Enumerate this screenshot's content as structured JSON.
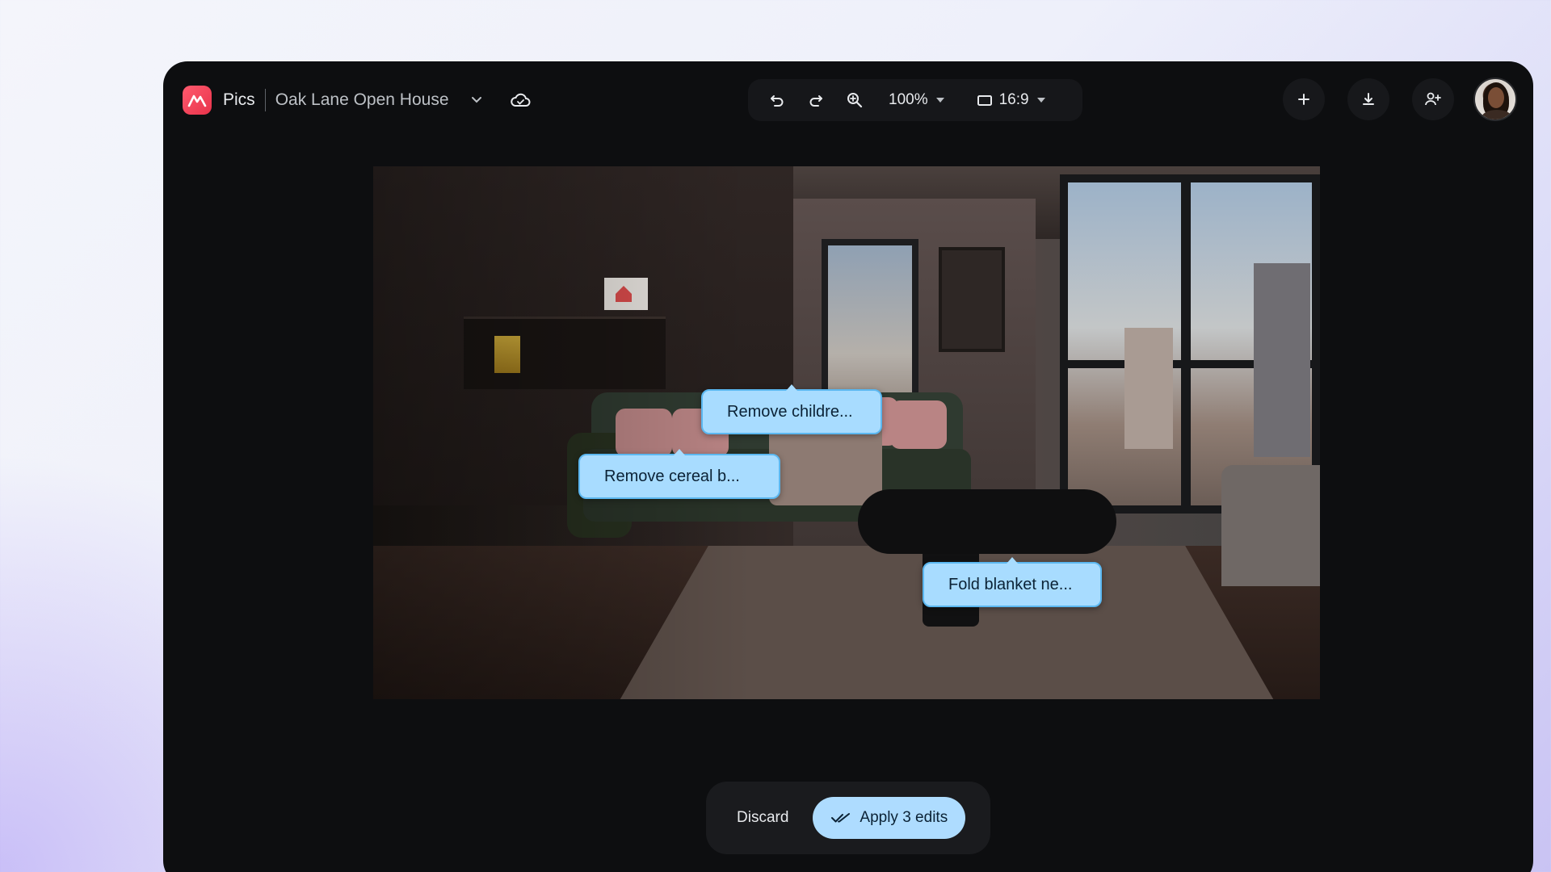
{
  "app": {
    "name": "Pics",
    "project": "Oak Lane Open House"
  },
  "toolbar": {
    "zoom": "100%",
    "aspect_ratio": "16:9"
  },
  "icons": {
    "logo": "pics-logo-icon",
    "project_menu": "chevron-down-icon",
    "sync": "cloud-icon",
    "undo": "undo-icon",
    "redo": "redo-icon",
    "zoom": "zoom-in-icon",
    "aspect": "aspect-ratio-icon",
    "add": "plus-icon",
    "download": "download-icon",
    "share": "person-add-icon"
  },
  "edits": [
    {
      "label": "Remove childre..."
    },
    {
      "label": "Remove cereal b..."
    },
    {
      "label": "Fold blanket ne..."
    }
  ],
  "actions": {
    "discard": "Discard",
    "apply": "Apply 3 edits"
  },
  "colors": {
    "accent": "#aedcff",
    "window_bg": "#0d0e10",
    "logo": "#ff4d64"
  }
}
